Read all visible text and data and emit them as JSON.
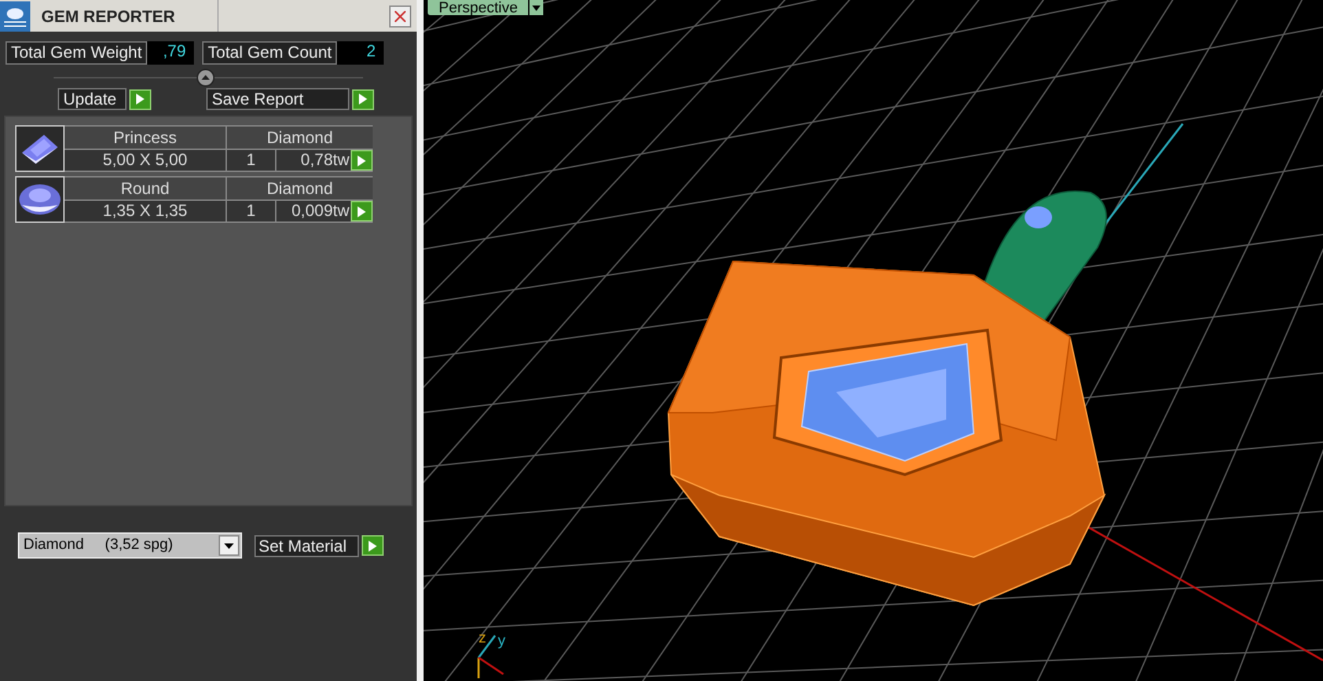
{
  "panel": {
    "title": "GEM REPORTER",
    "totals": [
      {
        "label": "Total Gem Weight",
        "value": ",79"
      },
      {
        "label": "Total Gem Count",
        "value": "2"
      }
    ],
    "actions": [
      {
        "label": "Update"
      },
      {
        "label": "Save Report"
      }
    ],
    "gems": [
      {
        "kind": "square",
        "cut": "Princess",
        "material": "Diamond",
        "size": "5,00 X 5,00",
        "count": "1",
        "weight": "0,78tw"
      },
      {
        "kind": "round",
        "cut": "Round",
        "material": "Diamond",
        "size": "1,35 X 1,35",
        "count": "1",
        "weight": "0,009tw"
      }
    ],
    "material_select": {
      "value": "Diamond     (3,52 spg)"
    },
    "set_material": "Set Material"
  },
  "viewport": {
    "label": "Perspective",
    "axes": [
      "z",
      "y"
    ]
  }
}
